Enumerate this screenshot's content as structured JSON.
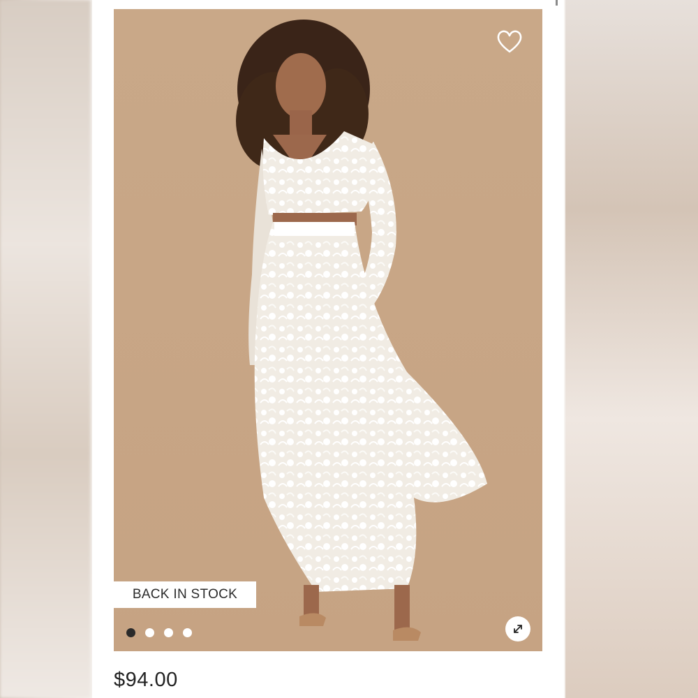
{
  "product": {
    "badge": "BACK IN STOCK",
    "price": "$94.00",
    "photo_alt": "",
    "carousel": {
      "count": 4,
      "active": 0
    }
  },
  "icons": {
    "favorite": "heart-icon",
    "expand": "expand-arrows-icon"
  },
  "colors": {
    "photo_background": "#c8a787",
    "dot_active": "#2a2a2a",
    "dot_inactive": "#ffffff"
  }
}
